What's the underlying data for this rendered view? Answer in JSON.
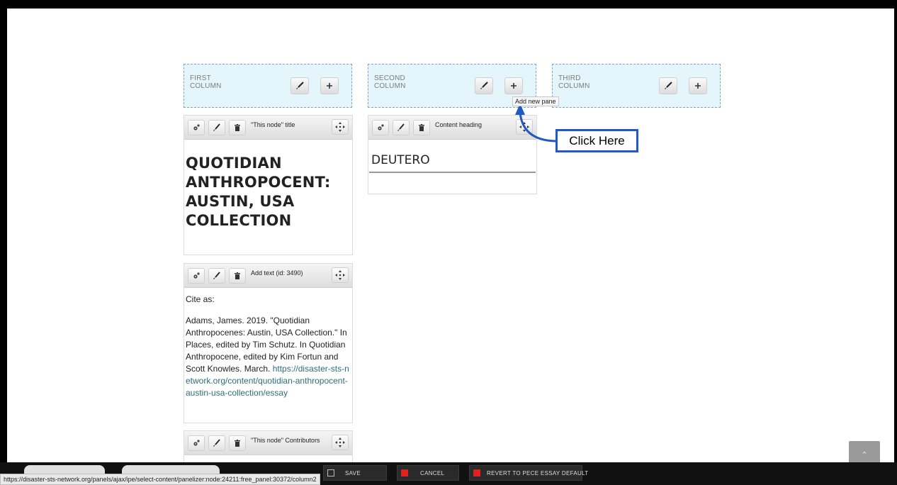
{
  "columns": [
    {
      "label_line1": "FIRST",
      "label_line2": "COLUMN",
      "edit_icon": "brush-icon",
      "add_icon": "plus-icon"
    },
    {
      "label_line1": "SECOND",
      "label_line2": "COLUMN",
      "edit_icon": "brush-icon",
      "add_icon": "plus-icon"
    },
    {
      "label_line1": "THIRD",
      "label_line2": "COLUMN",
      "edit_icon": "brush-icon",
      "add_icon": "plus-icon"
    }
  ],
  "tooltip": "Add new pane",
  "callout": "Click Here",
  "panes": {
    "node_title": {
      "bar_title": "\"This node\" title",
      "heading": "QUOTIDIAN ANTHROPOCENT: AUSTIN, USA COLLECTION"
    },
    "add_text": {
      "bar_title": "Add text (id: 3490)",
      "cite_label": "Cite as:",
      "citation": "Adams, James. 2019. \"Quotidian Anthropocenes: Austin, USA Collection.\" In Places, edited by Tim Schutz. In Quotidian Anthropocene, edited by Kim Fortun and Scott Knowles. March. ",
      "link": "https://disaster-sts-network.org/content/quotidian-anthropocent-austin-usa-collection/essay"
    },
    "contributors": {
      "bar_title": "\"This node\" Contributors"
    },
    "content_heading": {
      "bar_title": "Content heading",
      "heading": "DEUTERO"
    }
  },
  "toolbar": {
    "save": "SAVE",
    "cancel": "CANCEL",
    "revert": "REVERT TO PECE ESSAY DEFAULT"
  },
  "status_url": "https://disaster-sts-network.org/panels/ajax/ipe/select-content/panelizer:node:24211:free_panel:30372/column2",
  "colors": {
    "column_bg": "#e4f6fb",
    "column_border": "#7aa8c4",
    "callout_border": "#1f5bc1",
    "link": "#2d6e78",
    "toolbar_bg": "#111111",
    "cancel_red": "#dd2222"
  }
}
